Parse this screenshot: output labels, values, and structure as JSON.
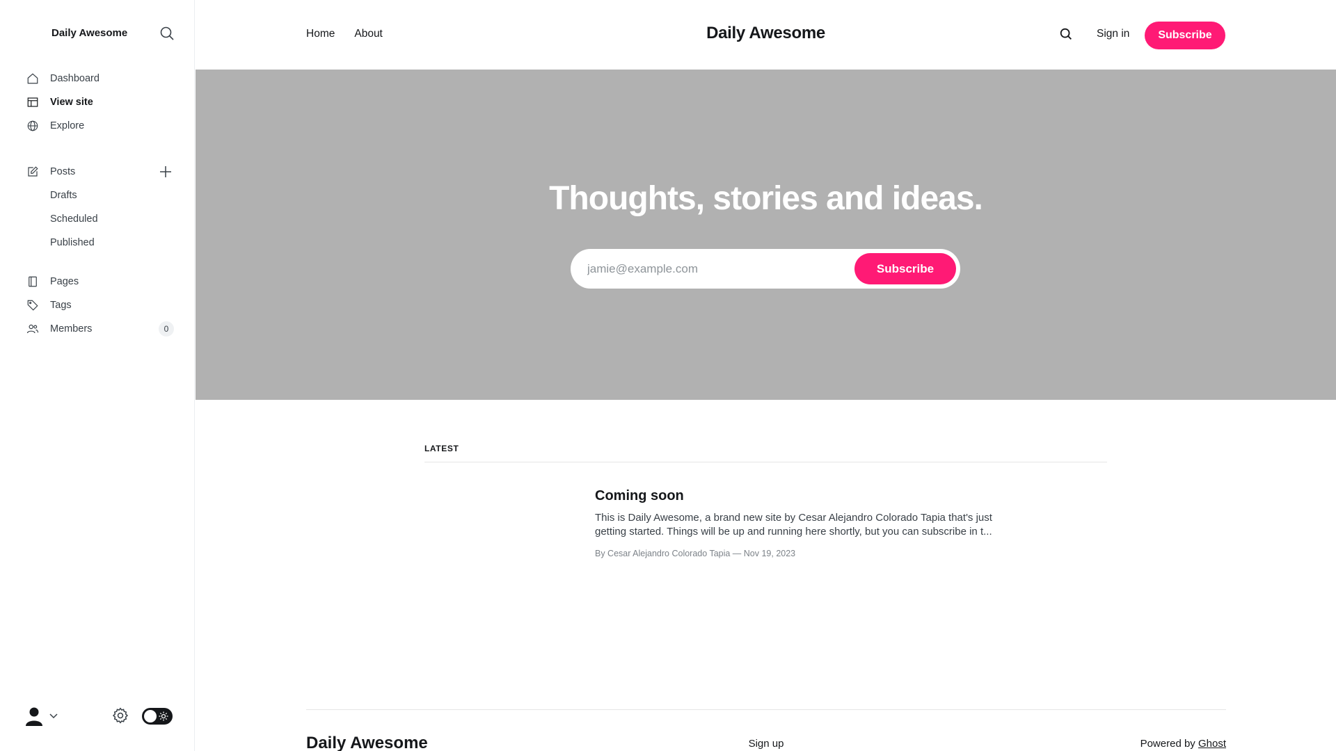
{
  "sidebar": {
    "site_title": "Daily Awesome",
    "nav": {
      "dashboard": "Dashboard",
      "view_site": "View site",
      "explore": "Explore"
    },
    "posts": {
      "label": "Posts",
      "drafts": "Drafts",
      "scheduled": "Scheduled",
      "published": "Published"
    },
    "pages": "Pages",
    "tags": "Tags",
    "members": {
      "label": "Members",
      "count": "0"
    }
  },
  "site": {
    "header": {
      "nav": [
        "Home",
        "About"
      ],
      "title": "Daily Awesome",
      "signin": "Sign in",
      "subscribe": "Subscribe"
    },
    "hero": {
      "title": "Thoughts, stories and ideas.",
      "email_placeholder": "jamie@example.com",
      "subscribe": "Subscribe"
    },
    "feed": {
      "label": "LATEST",
      "post": {
        "title": "Coming soon",
        "excerpt": "This is Daily Awesome, a brand new site by Cesar Alejandro Colorado Tapia that's just getting started. Things will be up and running here shortly, but you can subscribe in t...",
        "meta": "By Cesar Alejandro Colorado Tapia — Nov 19, 2023"
      }
    },
    "footer": {
      "title": "Daily Awesome",
      "signup": "Sign up",
      "powered_prefix": "Powered by ",
      "powered_link": "Ghost"
    }
  },
  "colors": {
    "accent": "#ff1a75",
    "hero_background": "#b1b1b1",
    "text": "#15171a"
  },
  "icons": {
    "sidebar_search": "search-icon",
    "dashboard": "home-icon",
    "view_site": "layout-icon",
    "explore": "globe-icon",
    "posts": "edit-icon",
    "new_post": "plus-icon",
    "pages": "page-icon",
    "tags": "tag-icon",
    "members": "members-icon",
    "user": "user-avatar-icon",
    "settings": "gear-icon",
    "theme_toggle": "sun-icon"
  }
}
